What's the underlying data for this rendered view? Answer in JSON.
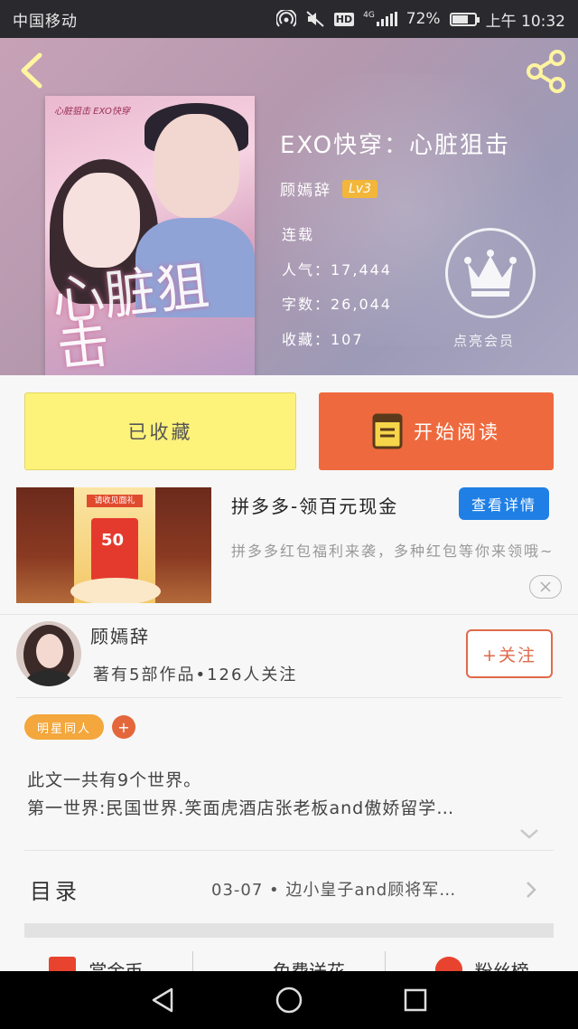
{
  "status_bar": {
    "carrier": "中国移动",
    "network": "4G",
    "hd_label": "HD",
    "battery": "72%",
    "battery_level": 0.72,
    "time": "上午 10:32"
  },
  "header": {
    "back_icon": "chevron-left-icon",
    "share_icon": "share-icon"
  },
  "book": {
    "cover_top_text": "心脏狙击 EXO快穿",
    "cover_calligraphy": "心脏狙击",
    "title": "EXO快穿：心脏狙击",
    "author": "顾嫣辞",
    "level": "Lv3",
    "status": "连载",
    "popularity": "人气：17,444",
    "word_count": "字数：26,044",
    "favorites": "收藏：107",
    "vip_label": "点亮会员",
    "vip_icon": "crown-icon"
  },
  "actions": {
    "favorite_label": "已收藏",
    "read_label": "开始阅读",
    "read_icon": "book-icon"
  },
  "ad": {
    "image_banner": "请收见面礼",
    "image_value": "50",
    "title": "拼多多-领百元现金",
    "detail_button": "查看详情",
    "description": "拼多多红包福利来袭，多种红包等你来领哦~",
    "close_icon": "close-icon"
  },
  "author_card": {
    "name": "顾嫣辞",
    "stats": "著有5部作品•126人关注",
    "follow_label": "+关注"
  },
  "tags": {
    "items": [
      "明星同人"
    ],
    "add_label": "+"
  },
  "intro": {
    "line1": "此文一共有9个世界。",
    "line2": "第一世界:民国世界.笑面虎酒店张老板and傲娇留学…",
    "expand_icon": "chevron-down-icon"
  },
  "toc": {
    "label": "目录",
    "latest": "03-07 • 边小皇子and顾将军…",
    "arrow_icon": "chevron-right-icon"
  },
  "bottom_tabs": [
    {
      "label": "赏金币",
      "icon": "gold-icon",
      "color": "#e8432e"
    },
    {
      "label": "免费送花",
      "icon": "flower-icon",
      "color": "#555555"
    },
    {
      "label": "粉丝榜",
      "icon": "fans-icon",
      "color": "#e8432e"
    }
  ],
  "colors": {
    "accent_orange": "#ee6a3e",
    "favorite_yellow": "#fdf27a",
    "detail_blue": "#1f7fe5",
    "tag_orange": "#f3a73c"
  }
}
